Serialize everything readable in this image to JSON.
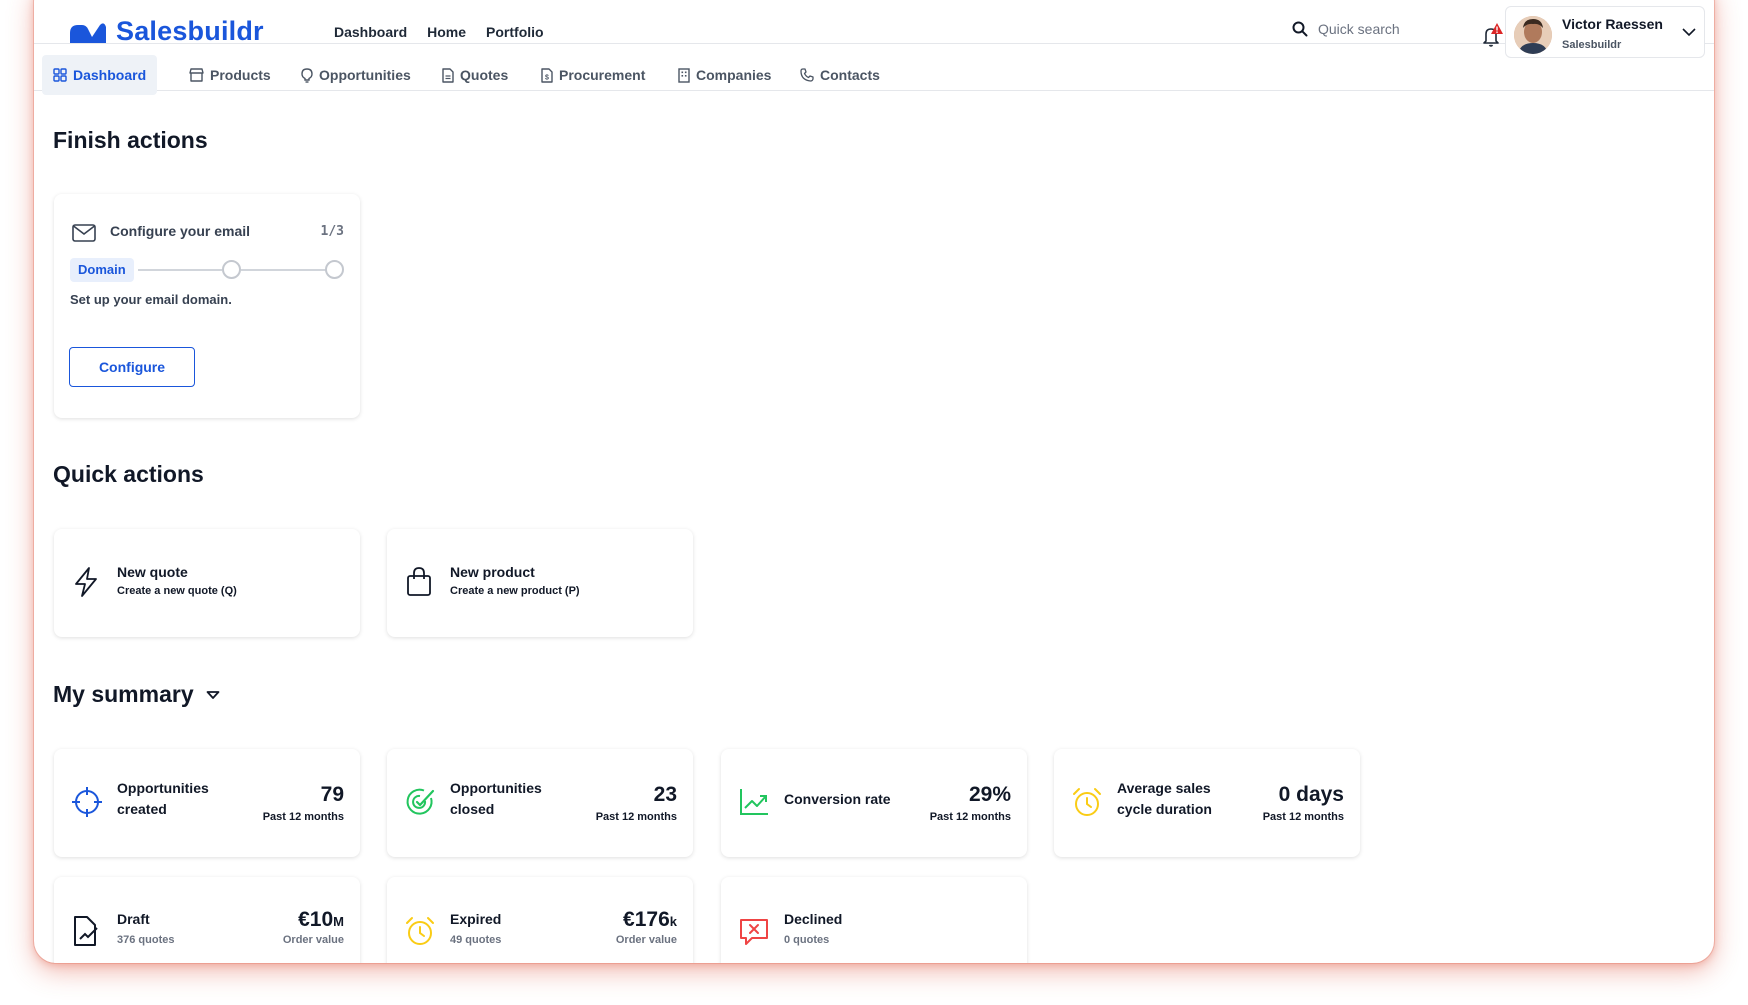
{
  "app": {
    "name": "Salesbuildr",
    "brand_color": "#1a56db"
  },
  "topnav": {
    "items": [
      "Dashboard",
      "Home",
      "Portfolio"
    ]
  },
  "search": {
    "placeholder": "Quick search"
  },
  "user": {
    "name": "Victor Raessen",
    "company": "Salesbuildr"
  },
  "tabs": [
    {
      "label": "Dashboard",
      "icon": "grid-icon",
      "active": true
    },
    {
      "label": "Products",
      "icon": "store-icon"
    },
    {
      "label": "Opportunities",
      "icon": "lightbulb-icon"
    },
    {
      "label": "Quotes",
      "icon": "document-icon"
    },
    {
      "label": "Procurement",
      "icon": "document-dollar-icon"
    },
    {
      "label": "Companies",
      "icon": "building-icon"
    },
    {
      "label": "Contacts",
      "icon": "phone-icon"
    }
  ],
  "finish_actions": {
    "heading": "Finish actions",
    "card": {
      "title": "Configure your email",
      "progress": "1/3",
      "step_label": "Domain",
      "description": "Set up your email domain.",
      "button": "Configure"
    }
  },
  "quick_actions": {
    "heading": "Quick actions",
    "items": [
      {
        "title": "New quote",
        "subtitle": "Create a new quote (Q)",
        "icon": "lightning-icon"
      },
      {
        "title": "New product",
        "subtitle": "Create a new product (P)",
        "icon": "shopping-bag-icon"
      }
    ]
  },
  "summary": {
    "heading": "My summary",
    "stats": [
      {
        "label_1": "Opportunities",
        "label_2": "created",
        "value": "79",
        "period": "Past 12 months",
        "icon": "crosshair-icon",
        "color": "#1a56db"
      },
      {
        "label_1": "Opportunities",
        "label_2": "closed",
        "value": "23",
        "period": "Past 12 months",
        "icon": "target-check-icon",
        "color": "#22c55e"
      },
      {
        "label_1": "Conversion rate",
        "label_2": "",
        "value": "29%",
        "period": "Past 12 months",
        "icon": "trend-up-icon",
        "color": "#22c55e"
      },
      {
        "label_1": "Average sales",
        "label_2": "cycle duration",
        "value": "0 days",
        "period": "Past 12 months",
        "icon": "alarm-icon",
        "color": "#facc15"
      }
    ],
    "quotes": [
      {
        "label": "Draft",
        "count": "376 quotes",
        "value": "€10",
        "unit": "M",
        "caption": "Order value",
        "icon": "draft-document-icon",
        "color": "#111827"
      },
      {
        "label": "Expired",
        "count": "49 quotes",
        "value": "€176",
        "unit": "k",
        "caption": "Order value",
        "icon": "alarm-icon",
        "color": "#facc15"
      },
      {
        "label": "Declined",
        "count": "0 quotes",
        "icon": "declined-message-icon",
        "color": "#ef4444"
      }
    ]
  }
}
